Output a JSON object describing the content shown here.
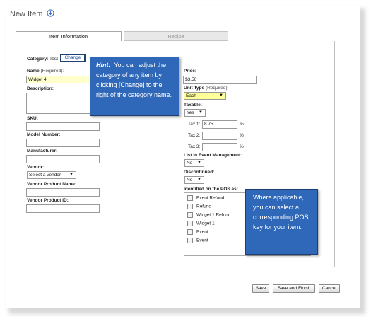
{
  "page": {
    "title": "New Item"
  },
  "tabs": [
    {
      "label": "Item Information"
    },
    {
      "label": "Recipe"
    }
  ],
  "category": {
    "label": "Category:",
    "value": "Test",
    "change_label": "Change"
  },
  "left_form": {
    "name_label": "Name",
    "name_required": "(Required):",
    "name_value": "Widget 4",
    "description_label": "Description:",
    "sku_label": "SKU:",
    "model_label": "Model Number:",
    "manufacturer_label": "Manufacturer:",
    "vendor_label": "Vendor:",
    "vendor_value": "Select a vendor",
    "vendor_product_name_label": "Vendor Product Name:",
    "vendor_product_id_label": "Vendor Product ID:"
  },
  "right_form": {
    "price_label": "Price:",
    "price_value": "$3.50",
    "unit_type_label": "Unit Type",
    "unit_type_required": "(Required):",
    "unit_type_value": "Each",
    "taxable_label": "Taxable:",
    "taxable_value": "Yes",
    "taxes": [
      {
        "label": "Tax 1:",
        "value": "8.75",
        "unit": "%"
      },
      {
        "label": "Tax 2:",
        "value": "",
        "unit": "%"
      },
      {
        "label": "Tax 3:",
        "value": "",
        "unit": "%"
      }
    ],
    "event_mgmt_label": "List in Event Management:",
    "event_mgmt_value": "No",
    "discontinued_label": "Discontinued:",
    "discontinued_value": "No",
    "pos_label": "Identified on the POS as:",
    "pos_items": [
      "Event Refund",
      "Refund",
      "Widget 1 Refund",
      "Widget 1",
      "Event",
      "Event"
    ]
  },
  "callouts": {
    "hint_title": "Hint:",
    "hint_text": "You can adjust the category of any item by clicking [Change] to the right of the category name.",
    "pos_text": "Where applicable, you can select a corresponding POS key for your item."
  },
  "buttons": {
    "save": "Save",
    "save_finish": "Save and Finish",
    "cancel": "Cancel"
  }
}
